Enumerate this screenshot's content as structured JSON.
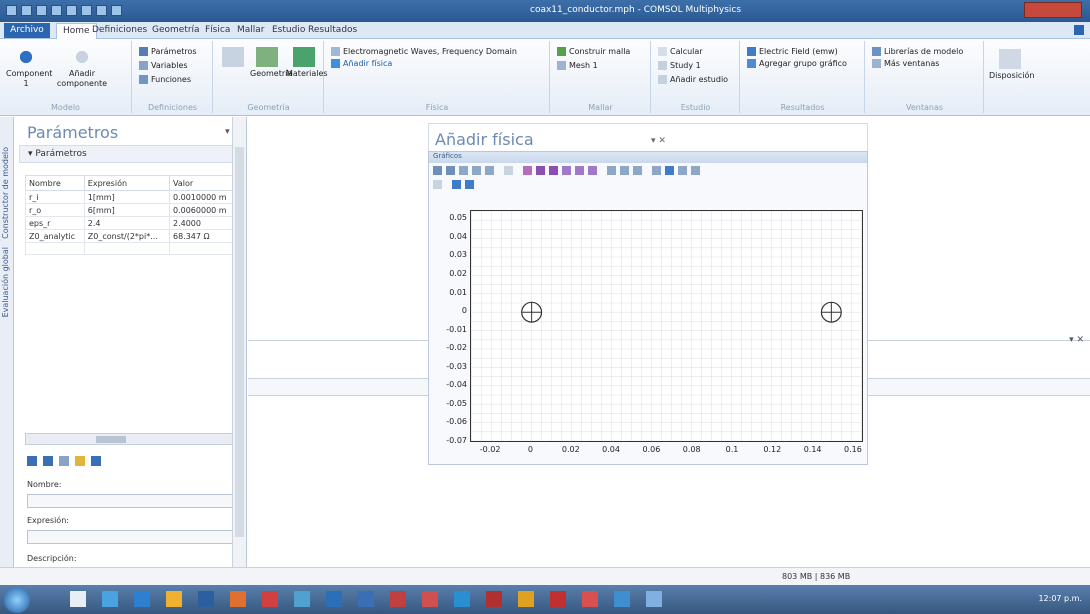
{
  "window": {
    "title": "coax11_conductor.mph - COMSOL Multiphysics"
  },
  "menu": {
    "file": "Archivo",
    "tabs": [
      "Home",
      "Definiciones",
      "Geometría",
      "Física",
      "Mallar",
      "Estudio",
      "Resultados"
    ]
  },
  "ribbon": {
    "modelo": {
      "component": "Component 1",
      "add_component": "Añadir componente",
      "label": "Modelo"
    },
    "definiciones": {
      "params": "Parámetros",
      "variables": "Variables",
      "functions": "Funciones",
      "label": "Definiciones"
    },
    "geometria": {
      "import": "",
      "geometry": "Geometría",
      "materials": "Materiales",
      "label": "Geometría"
    },
    "fisica": {
      "physics": "Electromagnetic Waves, Frequency Domain",
      "add": "Añadir física",
      "label": "Física"
    },
    "mallar": {
      "build": "Construir malla",
      "mesh": "Mesh 1",
      "label": "Mallar"
    },
    "estudio": {
      "compute": "Calcular",
      "study": "Study 1",
      "add": "Añadir estudio",
      "label": "Estudio"
    },
    "resultados": {
      "field": "Electric Field (emw)",
      "group": "Agregar grupo gráfico",
      "label": "Resultados"
    },
    "ventanas": {
      "libs": "Librerías de modelo",
      "more": "Más ventanas",
      "label": "Ventanas"
    },
    "disposicion": {
      "label": "Disposición"
    }
  },
  "left_strip": {
    "model_builder": "Constructor de modelo",
    "global_eval": "Evaluación global"
  },
  "params_panel": {
    "title": "Parámetros",
    "section": "Parámetros",
    "headers": [
      "Nombre",
      "Expresión",
      "Valor"
    ],
    "rows": [
      [
        "r_i",
        "1[mm]",
        "0.0010000 m"
      ],
      [
        "r_o",
        "6[mm]",
        "0.0060000 m"
      ],
      [
        "eps_r",
        "2.4",
        "2.4000"
      ],
      [
        "Z0_analytic",
        "Z0_const/(2*pi*...",
        "68.347 Ω"
      ]
    ],
    "name_label": "Nombre:",
    "expr_label": "Expresión:",
    "desc_label": "Descripción:"
  },
  "physics_panel": {
    "title": "Añadir física"
  },
  "graphics": {
    "header": "Gráficos"
  },
  "chart_data": {
    "type": "scatter",
    "x_ticks": [
      "-0.02",
      "0",
      "0.02",
      "0.04",
      "0.06",
      "0.08",
      "0.1",
      "0.12",
      "0.14",
      "0.16"
    ],
    "y_ticks": [
      "0.05",
      "0.04",
      "0.03",
      "0.02",
      "0.01",
      "0",
      "-0.01",
      "-0.02",
      "-0.03",
      "-0.04",
      "-0.05",
      "-0.06",
      "-0.07"
    ],
    "xlim": [
      -0.03,
      0.165
    ],
    "ylim": [
      -0.07,
      0.055
    ],
    "points": [
      {
        "x": 0.0,
        "y": 0.0
      },
      {
        "x": 0.15,
        "y": 0.0
      }
    ],
    "grid": true
  },
  "statusbar": {
    "memory": "803 MB | 836 MB"
  },
  "taskbar": {
    "time": "12:07 p.m."
  }
}
